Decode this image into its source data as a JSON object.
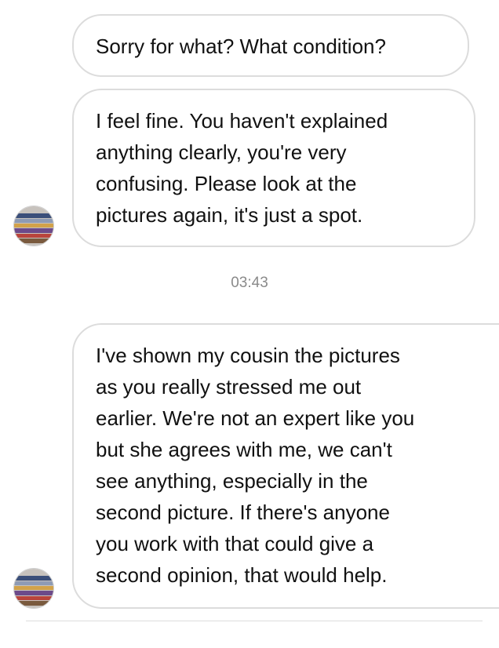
{
  "conversation": {
    "messages": [
      {
        "text": "Sorry for what? What condition?"
      },
      {
        "text": "I feel fine. You haven't explained\nanything clearly, you're very\nconfusing. Please look at the\npictures again, it's just a spot."
      },
      {
        "text": "I've shown my cousin the pictures\nas you really stressed me out\nearlier. We're not an expert like you\nbut she agrees with me, we can't\nsee anything, especially in the\nsecond picture. If there's anyone\nyou work with that could give a\nsecond opinion, that would help."
      }
    ],
    "timestamp": "03:43"
  },
  "colors": {
    "bubble_border": "#dcdcdc",
    "timestamp": "#8a8a8a",
    "text": "#111111"
  },
  "icons": {
    "avatar": "avatar-icon"
  }
}
